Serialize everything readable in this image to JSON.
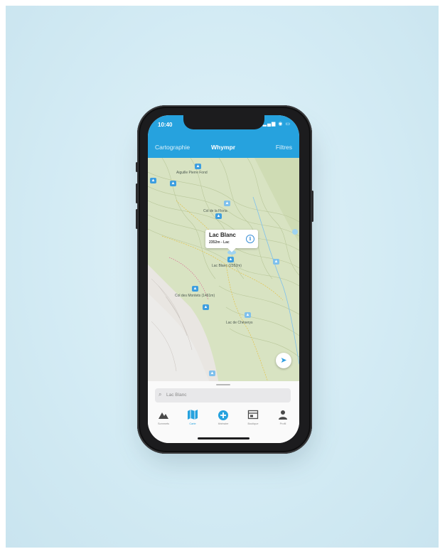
{
  "status": {
    "time": "10:40",
    "icons": "▂▄▆ ◉ ▭"
  },
  "header": {
    "left": "Cartographie",
    "title": "Whympr",
    "right": "Filtres"
  },
  "map": {
    "callout": {
      "title": "Lac Blanc",
      "subtitle": "2352m - Lac"
    },
    "labels": {
      "l1": "Aiguille Pierre Fond",
      "l2": "Col de la Floria",
      "l3": "Lac Blanc (2352m)",
      "l4": "Col des Montets (1461m)",
      "l5": "Lac de Chéserys"
    }
  },
  "search": {
    "value": "Lac Blanc"
  },
  "tabs": [
    {
      "label": "Sommets",
      "icon": "mountain-icon"
    },
    {
      "label": "Carte",
      "icon": "map-icon"
    },
    {
      "label": "Itinéraire",
      "icon": "plus-icon"
    },
    {
      "label": "Boutique",
      "icon": "store-icon"
    },
    {
      "label": "Profil",
      "icon": "person-icon"
    }
  ],
  "colors": {
    "accent": "#26a2de",
    "poi": "#3d9ee0",
    "background": "#d6edf6"
  }
}
